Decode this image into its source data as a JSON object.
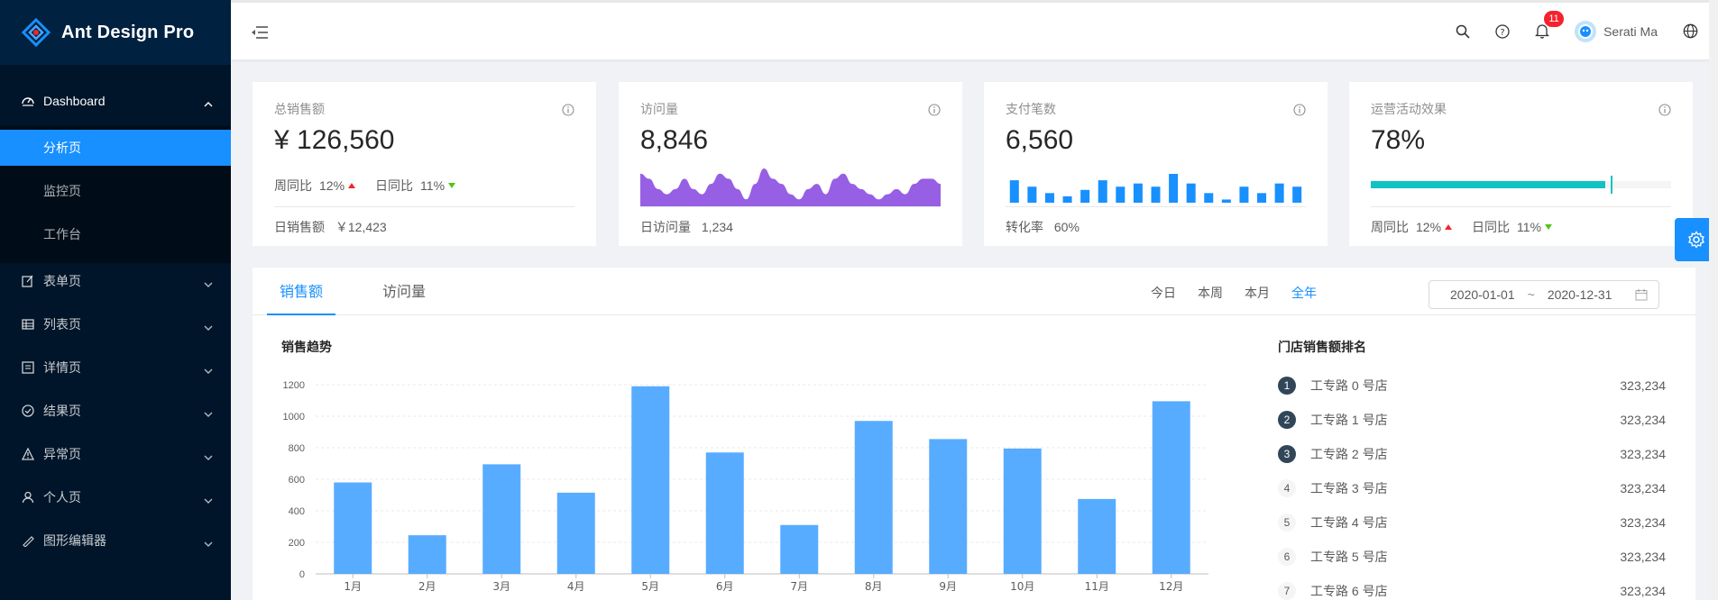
{
  "app": {
    "title": "Ant Design Pro"
  },
  "sidebar": {
    "items": [
      {
        "label": "Dashboard",
        "icon": "dashboard-icon",
        "open": true,
        "children": [
          {
            "label": "分析页",
            "active": true
          },
          {
            "label": "监控页"
          },
          {
            "label": "工作台"
          }
        ]
      },
      {
        "label": "表单页",
        "icon": "form-icon"
      },
      {
        "label": "列表页",
        "icon": "table-icon"
      },
      {
        "label": "详情页",
        "icon": "profile-icon"
      },
      {
        "label": "结果页",
        "icon": "check-circle-icon"
      },
      {
        "label": "异常页",
        "icon": "warning-icon"
      },
      {
        "label": "个人页",
        "icon": "user-icon"
      },
      {
        "label": "图形编辑器",
        "icon": "highlight-icon"
      }
    ]
  },
  "header": {
    "notification_count": "11",
    "username": "Serati Ma"
  },
  "cards": {
    "sales": {
      "label": "总销售额",
      "value": "¥ 126,560",
      "wow_label": "周同比",
      "wow": "12%",
      "dod_label": "日同比",
      "dod": "11%",
      "footer_label": "日销售额",
      "footer_value": "￥12,423"
    },
    "visits": {
      "label": "访问量",
      "value": "8,846",
      "footer_label": "日访问量",
      "footer_value": "1,234",
      "area": [
        6,
        5,
        3,
        2,
        3,
        5,
        3,
        2,
        4,
        6,
        5,
        3,
        1,
        4,
        7,
        5,
        4,
        2,
        1,
        3,
        4,
        2,
        5,
        6,
        4,
        3,
        2,
        1,
        2,
        3,
        2,
        4,
        5,
        5,
        4
      ]
    },
    "payments": {
      "label": "支付笔数",
      "value": "6,560",
      "footer_label": "转化率",
      "footer_value": "60%",
      "bars": [
        7,
        5,
        3,
        2,
        4,
        7,
        5,
        6,
        5,
        9,
        6,
        3,
        1,
        5,
        3,
        6,
        5
      ]
    },
    "operations": {
      "label": "运营活动效果",
      "value": "78%",
      "progress": 0.78,
      "target": 0.8,
      "wow_label": "周同比",
      "wow": "12%",
      "dod_label": "日同比",
      "dod": "11%"
    }
  },
  "sales_panel": {
    "tabs": [
      "销售额",
      "访问量"
    ],
    "ranges": [
      "今日",
      "本周",
      "本月",
      "全年"
    ],
    "active_range": "全年",
    "date_start": "2020-01-01",
    "date_sep": "~",
    "date_end": "2020-12-31",
    "chart_title": "销售趋势",
    "ranking_title": "门店销售额排名",
    "ranking": [
      {
        "rank": "1",
        "name": "工专路 0 号店",
        "value": "323,234"
      },
      {
        "rank": "2",
        "name": "工专路 1 号店",
        "value": "323,234"
      },
      {
        "rank": "3",
        "name": "工专路 2 号店",
        "value": "323,234"
      },
      {
        "rank": "4",
        "name": "工专路 3 号店",
        "value": "323,234"
      },
      {
        "rank": "5",
        "name": "工专路 4 号店",
        "value": "323,234"
      },
      {
        "rank": "6",
        "name": "工专路 5 号店",
        "value": "323,234"
      },
      {
        "rank": "7",
        "name": "工专路 6 号店",
        "value": "323,234"
      }
    ]
  },
  "chart_data": {
    "type": "bar",
    "title": "销售趋势",
    "categories": [
      "1月",
      "2月",
      "3月",
      "4月",
      "5月",
      "6月",
      "7月",
      "8月",
      "9月",
      "10月",
      "11月",
      "12月"
    ],
    "values": [
      580,
      245,
      695,
      515,
      1190,
      770,
      310,
      970,
      855,
      795,
      475,
      1095
    ],
    "ylim": [
      0,
      1200
    ],
    "yticks": [
      0,
      200,
      400,
      600,
      800,
      1000,
      1200
    ],
    "grid": true,
    "bar_color": "#58acff"
  },
  "colors": {
    "primary": "#1890ff",
    "sider": "#001529",
    "area": "#975fe4",
    "progress": "#13c2c2"
  }
}
